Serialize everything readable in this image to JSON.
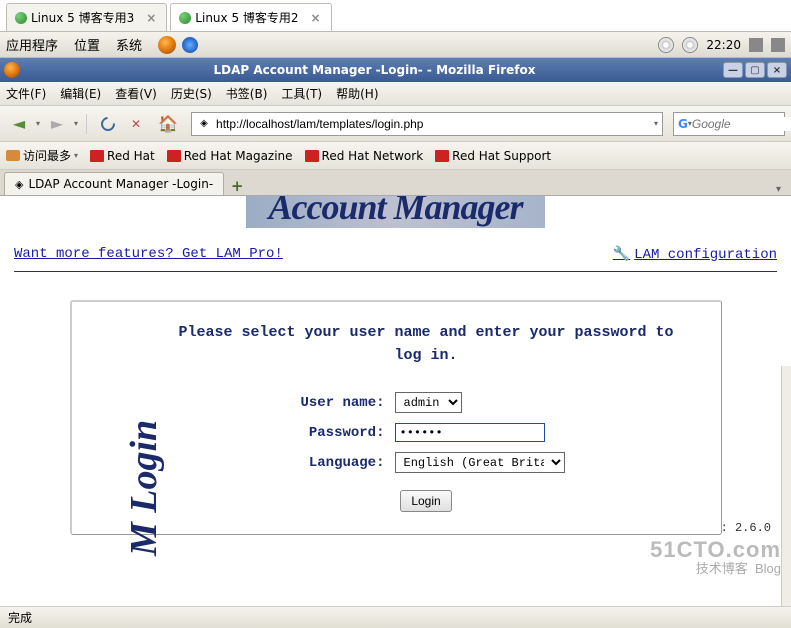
{
  "os_tabs": {
    "items": [
      {
        "label": "Linux 5 博客专用3"
      },
      {
        "label": "Linux 5 博客专用2"
      }
    ]
  },
  "gnome": {
    "apps": "应用程序",
    "places": "位置",
    "system": "系统",
    "time": "22:20"
  },
  "window": {
    "title": "LDAP Account Manager -Login- - Mozilla Firefox"
  },
  "menubar": {
    "items": [
      "文件(F)",
      "编辑(E)",
      "查看(V)",
      "历史(S)",
      "书签(B)",
      "工具(T)",
      "帮助(H)"
    ]
  },
  "nav": {
    "url": "http://localhost/lam/templates/login.php",
    "search_placeholder": "Google"
  },
  "bookmarks": {
    "most": "访问最多",
    "items": [
      "Red Hat",
      "Red Hat Magazine",
      "Red Hat Network",
      "Red Hat Support"
    ]
  },
  "browser_tabs": {
    "items": [
      {
        "label": "LDAP Account Manager -Login-"
      }
    ]
  },
  "page": {
    "banner": "Account Manager",
    "promo_link": "Want more features? Get LAM Pro!",
    "config_link": "LAM configuration",
    "login_side": "M  Login",
    "prompt": "Please select your user name and enter your password to log in.",
    "labels": {
      "user": "User name:",
      "password": "Password:",
      "language": "Language:"
    },
    "user_options": [
      "admin"
    ],
    "password_value": "••••••",
    "language_options": [
      "English (Great Britain)"
    ],
    "login_button": "Login",
    "version": ": 2.6.0"
  },
  "statusbar": {
    "text": "完成"
  },
  "watermark": {
    "line1": "51CTO.com",
    "line2": "技术博客",
    "line3": "Blog"
  }
}
